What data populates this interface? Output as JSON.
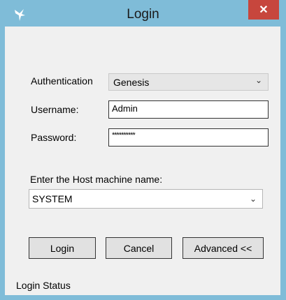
{
  "window": {
    "title": "Login",
    "close_glyph": "✕",
    "icon": "bird-icon"
  },
  "form": {
    "authentication_label": "Authentication",
    "authentication_value": "Genesis",
    "username_label": "Username:",
    "username_value": "Admin",
    "password_label": "Password:",
    "password_value": "**********",
    "host_label": "Enter the Host machine name:",
    "host_value": "SYSTEM"
  },
  "buttons": {
    "login": "Login",
    "cancel": "Cancel",
    "advanced": "Advanced <<"
  },
  "status": {
    "text": "Login Status"
  }
}
